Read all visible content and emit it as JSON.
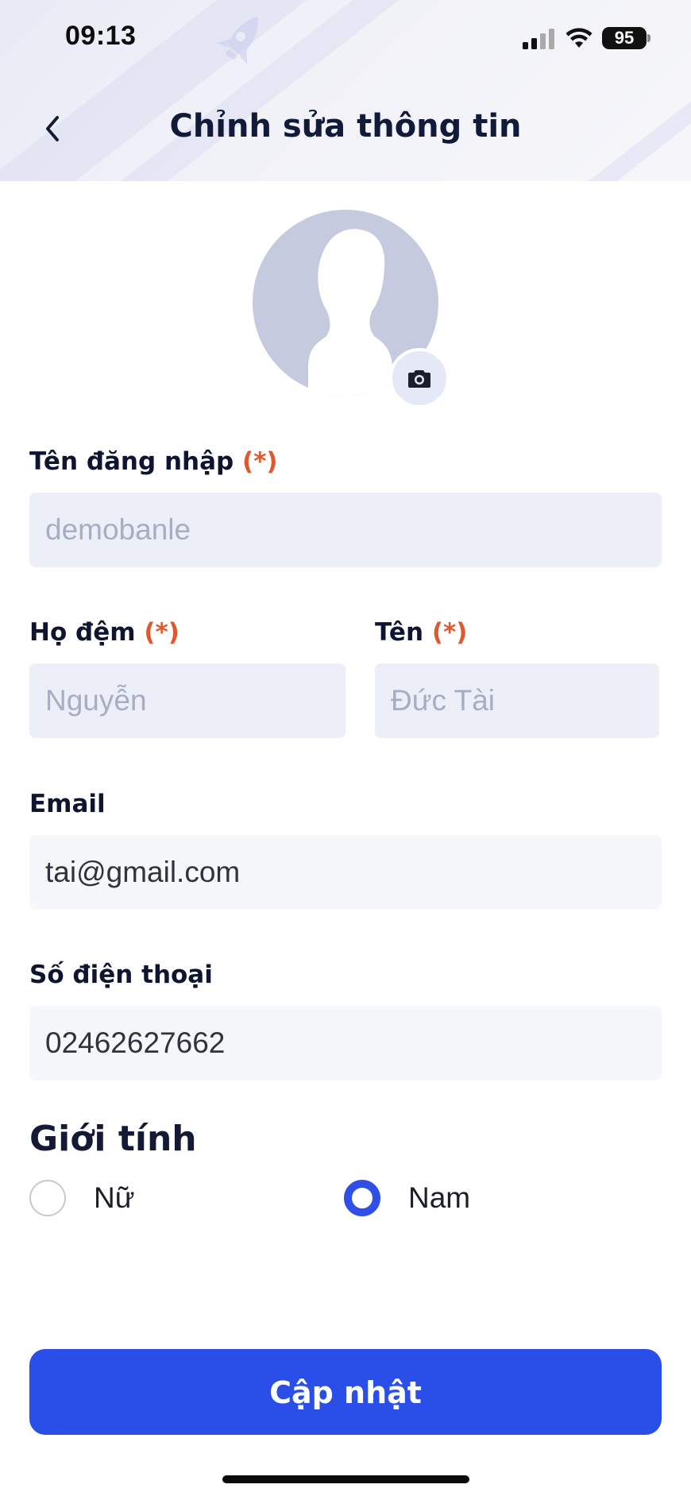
{
  "status_bar": {
    "time": "09:13",
    "battery": "95"
  },
  "header": {
    "title": "Chỉnh sửa thông tin",
    "back_icon": "chevron-left-icon"
  },
  "avatar": {
    "icon": "user-silhouette-icon",
    "camera_icon": "camera-icon"
  },
  "form": {
    "required_mark": "(*)",
    "username": {
      "label": "Tên đăng nhập",
      "value": "demobanle"
    },
    "last_name": {
      "label": "Họ đệm",
      "value": "Nguyễn"
    },
    "first_name": {
      "label": "Tên",
      "value": "Đức Tài"
    },
    "email": {
      "label": "Email",
      "value": "tai@gmail.com"
    },
    "phone": {
      "label": "Số điện thoại",
      "value": "02462627662"
    }
  },
  "gender": {
    "title": "Giới tính",
    "options": [
      {
        "label": "Nữ",
        "selected": false
      },
      {
        "label": "Nam",
        "selected": true
      }
    ]
  },
  "submit": {
    "label": "Cập nhật"
  },
  "colors": {
    "accent": "#2a4fe8",
    "required": "#e0572d",
    "disabled_field": "#eceef8",
    "editable_field": "#f6f7fb"
  }
}
